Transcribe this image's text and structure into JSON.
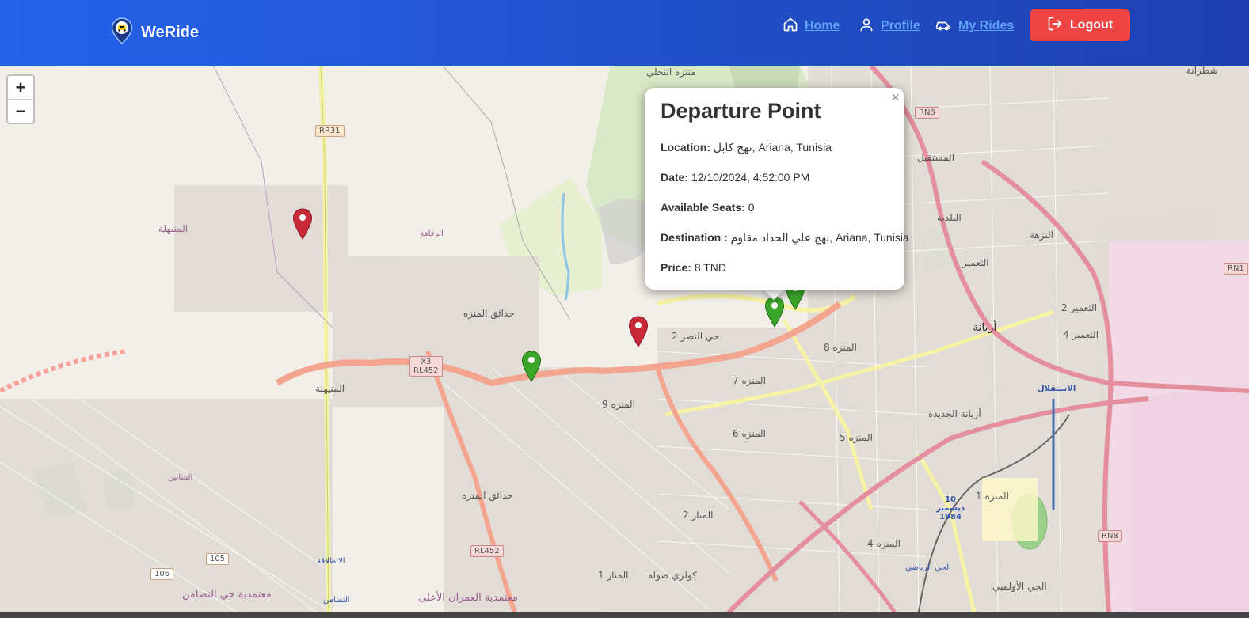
{
  "nav": {
    "brand": "WeRide",
    "home": "Home",
    "profile": "Profile",
    "my_rides": "My Rides",
    "logout": "Logout"
  },
  "zoom": {
    "in": "+",
    "out": "−"
  },
  "popup": {
    "title": "Departure Point",
    "location_label": "Location:",
    "location_value": "نهج كابل, Ariana, Tunisia",
    "date_label": "Date:",
    "date_value": "12/10/2024, 4:52:00 PM",
    "seats_label": "Available Seats:",
    "seats_value": "0",
    "destination_label": "Destination :",
    "destination_value": "نهج علي الحداد مقاوم, Ariana, Tunisia",
    "price_label": "Price:",
    "price_value": "8 TND",
    "close": "×"
  },
  "map_labels": {
    "l1": "منتزه النحلي",
    "l2": "المستقبل",
    "l3": "المنيهلة",
    "l4": "الرفاهة",
    "l5": "حدائق المنزه",
    "l6": "حي النصر 2",
    "l7": "المنزه 8",
    "l8": "أريانة",
    "l9": "المنزه 7",
    "l10": "المنزه 9",
    "l11": "المنزه 6",
    "l12": "المنزه 5",
    "l13": "أريانة الجديدة",
    "l14": "المنزه 1",
    "l15": "المنار 2",
    "l16": "المنار 1",
    "l17": "المنزه 4",
    "l18": "التعمير",
    "l19": "النزهة",
    "l20": "البلدية",
    "l21": "الاستقلال",
    "l22": "شطرانة",
    "l23": "المنيهلة",
    "l24": "التضامن",
    "l25": "الانطلاقة",
    "l26": "الحي الرياضي",
    "l27": "الحي الأولمبي",
    "l28": "حدائق المنزه",
    "l29": "السائين",
    "l30": "معتمدية حي التضامن",
    "l31": "معتمدية العمران الأعلى",
    "l32": "كولزي صولة",
    "l33": "10 ديسمبر 1984",
    "l34": "التعمير 2",
    "l35": "التعمير 4"
  },
  "shields": {
    "rr31": "RR31",
    "x3": "X3\nRL452",
    "rl452": "RL452",
    "rn8a": "RN8",
    "rn8b": "RN8",
    "rn1": "RN1",
    "r105": "105",
    "r106": "106"
  },
  "markers": [
    {
      "kind": "red",
      "color": "#c92a3a"
    },
    {
      "kind": "red",
      "color": "#c92a3a"
    },
    {
      "kind": "green",
      "color": "#3aa629"
    },
    {
      "kind": "green",
      "color": "#3aa629"
    },
    {
      "kind": "green",
      "color": "#3aa629"
    }
  ]
}
